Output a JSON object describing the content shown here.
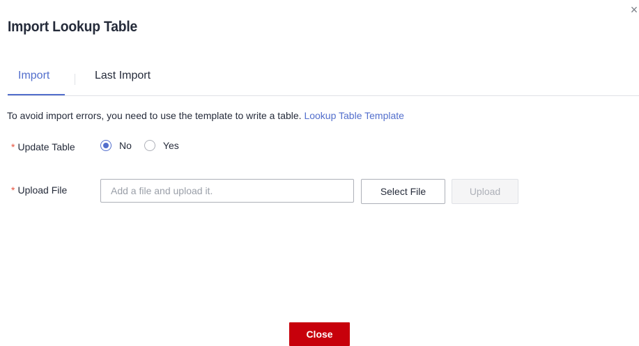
{
  "dialog": {
    "title": "Import Lookup Table",
    "close_icon": "close-icon"
  },
  "tabs": [
    {
      "label": "Import",
      "active": true
    },
    {
      "label": "Last Import",
      "active": false
    }
  ],
  "hint": {
    "text": "To avoid import errors, you need to use the template to write a table.",
    "link_text": "Lookup Table Template"
  },
  "form": {
    "update_table": {
      "label": "Update Table",
      "required_mark": "*",
      "options": [
        {
          "label": "No",
          "checked": true
        },
        {
          "label": "Yes",
          "checked": false
        }
      ]
    },
    "upload_file": {
      "label": "Upload File",
      "required_mark": "*",
      "placeholder": "Add a file and upload it.",
      "select_button": "Select File",
      "upload_button": "Upload"
    }
  },
  "footer": {
    "close_button": "Close"
  },
  "colors": {
    "accent": "#526ecc",
    "danger": "#c7000b",
    "required": "#e6513d"
  }
}
